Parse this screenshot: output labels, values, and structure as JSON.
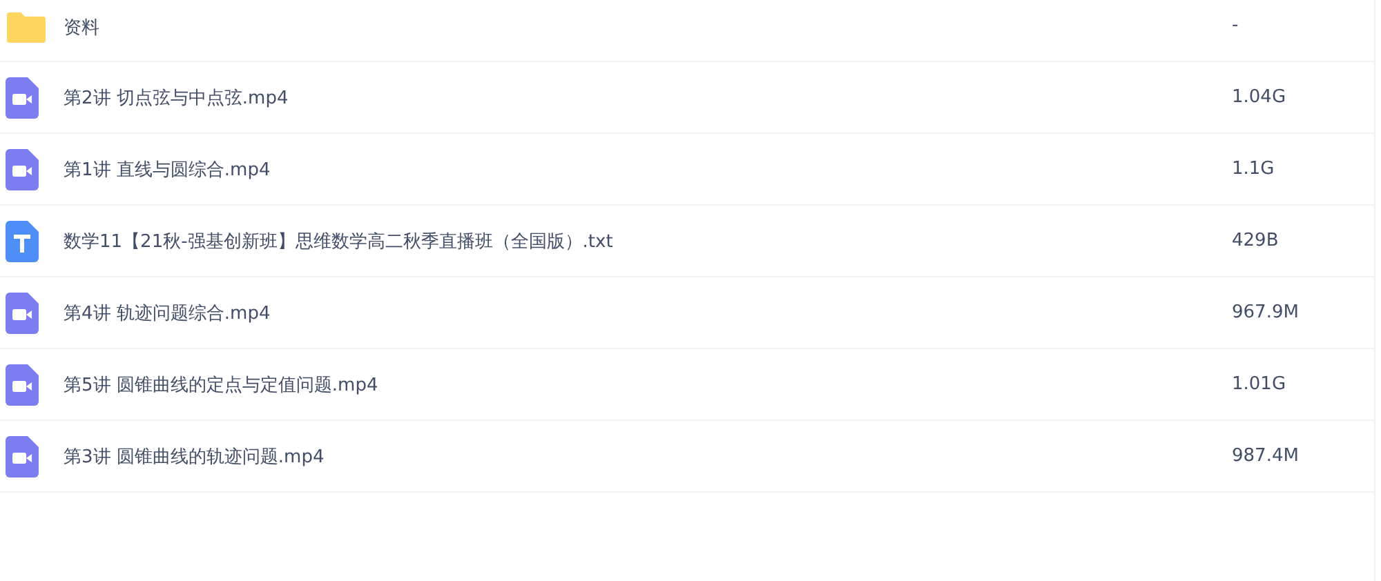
{
  "files": [
    {
      "kind": "folder",
      "name": "资料",
      "size": "-"
    },
    {
      "kind": "video",
      "name": "第2讲 切点弦与中点弦.mp4",
      "size": "1.04G"
    },
    {
      "kind": "video",
      "name": "第1讲 直线与圆综合.mp4",
      "size": "1.1G"
    },
    {
      "kind": "text",
      "name": "数学11【21秋-强基创新班】思维数学高二秋季直播班（全国版）.txt",
      "size": "429B"
    },
    {
      "kind": "video",
      "name": "第4讲 轨迹问题综合.mp4",
      "size": "967.9M"
    },
    {
      "kind": "video",
      "name": "第5讲 圆锥曲线的定点与定值问题.mp4",
      "size": "1.01G"
    },
    {
      "kind": "video",
      "name": "第3讲 圆锥曲线的轨迹问题.mp4",
      "size": "987.4M"
    }
  ]
}
